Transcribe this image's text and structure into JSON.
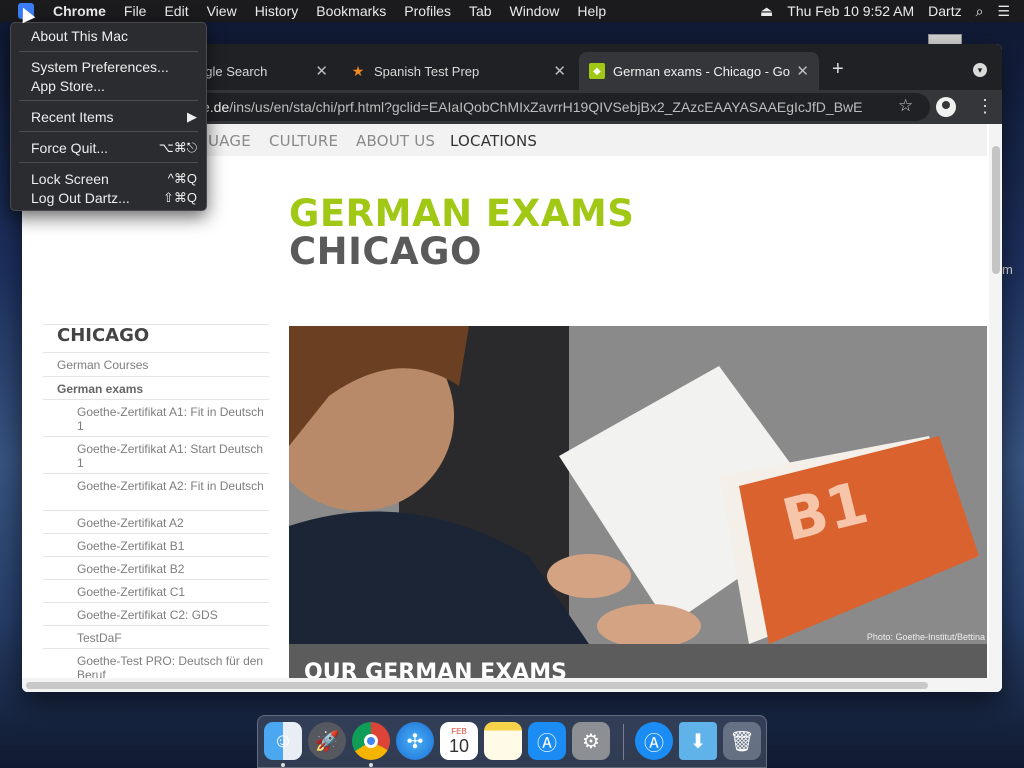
{
  "menubar": {
    "app_name": "Chrome",
    "menus": [
      "File",
      "Edit",
      "View",
      "History",
      "Bookmarks",
      "Profiles",
      "Tab",
      "Window",
      "Help"
    ],
    "clock": "Thu Feb 10  9:52 AM",
    "user": "Dartz"
  },
  "apple_menu": {
    "about": "About This Mac",
    "system_prefs": "System Preferences...",
    "app_store": "App Store...",
    "recent_items": "Recent Items",
    "force_quit": "Force Quit...",
    "force_quit_shortcut": "⌥⌘⎋",
    "lock_screen": "Lock Screen",
    "lock_screen_shortcut": "^⌘Q",
    "log_out": "Log Out Dartz...",
    "log_out_shortcut": "⇧⌘Q"
  },
  "browser": {
    "tabs": [
      {
        "title": "ogle Search"
      },
      {
        "title": "Spanish Test Prep"
      },
      {
        "title": "German exams - Chicago - Go"
      }
    ],
    "url_host": "e.de",
    "url_path": "/ins/us/en/sta/chi/prf.html?gclid=EAIaIQobChMIxZavrrH19QIVSebjBx2_ZAzcEAAYASAAEgIcJfD_BwE"
  },
  "page": {
    "nav": [
      "UAGE",
      "CULTURE",
      "ABOUT US",
      "LOCATIONS"
    ],
    "heading_line1": "GERMAN EXAMS",
    "heading_line2": "CHICAGO",
    "sidebar": {
      "title": "CHICAGO",
      "courses": "German Courses",
      "exams": "German exams",
      "items": [
        "Goethe-Zertifikat A1: Fit in Deutsch 1",
        "Goethe-Zertifikat A1: Start Deutsch 1",
        "Goethe-Zertifikat A2: Fit in Deutsch",
        "Goethe-Zertifikat A2",
        "Goethe-Zertifikat B1",
        "Goethe-Zertifikat B2",
        "Goethe-Zertifikat C1",
        "Goethe-Zertifikat C2: GDS",
        "TestDaF",
        "Goethe-Test PRO: Deutsch für den Beruf"
      ]
    },
    "hero_caption": "Photo: Goethe-Institut/Bettina",
    "hero_book_label": "B1",
    "exams_title": "OUR GERMAN EXAMS"
  },
  "desktop": {
    "side_text": "m"
  },
  "dock": {
    "calendar_month": "FEB",
    "calendar_day": "10",
    "items": [
      "finder-icon",
      "launchpad-icon",
      "chrome-icon",
      "safari-icon",
      "calendar-icon",
      "notes-icon",
      "app-store-icon",
      "system-preferences-icon",
      "app-store-icon",
      "downloads-folder-icon",
      "trash-icon"
    ]
  },
  "colors": {
    "accent_green": "#a0c814",
    "heading_gray": "#5a5a5a",
    "menu_bg": "#2b2c2f"
  }
}
